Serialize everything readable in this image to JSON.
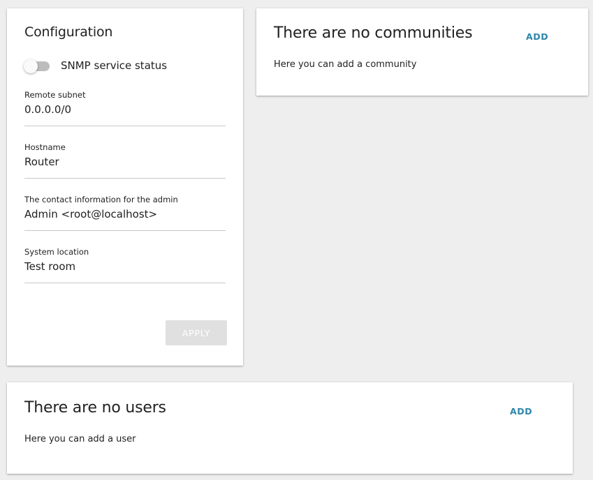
{
  "config": {
    "title": "Configuration",
    "snmp_toggle": {
      "label": "SNMP service status",
      "enabled": false
    },
    "fields": {
      "remote_subnet": {
        "label": "Remote subnet",
        "value": "0.0.0.0/0"
      },
      "hostname": {
        "label": "Hostname",
        "value": "Router"
      },
      "contact": {
        "label": "The contact information for the admin",
        "value": "Admin <root@localhost>"
      },
      "location": {
        "label": "System location",
        "value": "Test room"
      }
    },
    "apply_label": "APPLY"
  },
  "communities": {
    "title": "There are no communities",
    "add_label": "ADD",
    "description": "Here you can add a community"
  },
  "users": {
    "title": "There are no users",
    "add_label": "ADD",
    "description": "Here you can add a user"
  },
  "colors": {
    "accent": "#2e86ab",
    "background": "#eeeeee",
    "card": "#ffffff",
    "disabled_button": "#e0e0e0"
  }
}
